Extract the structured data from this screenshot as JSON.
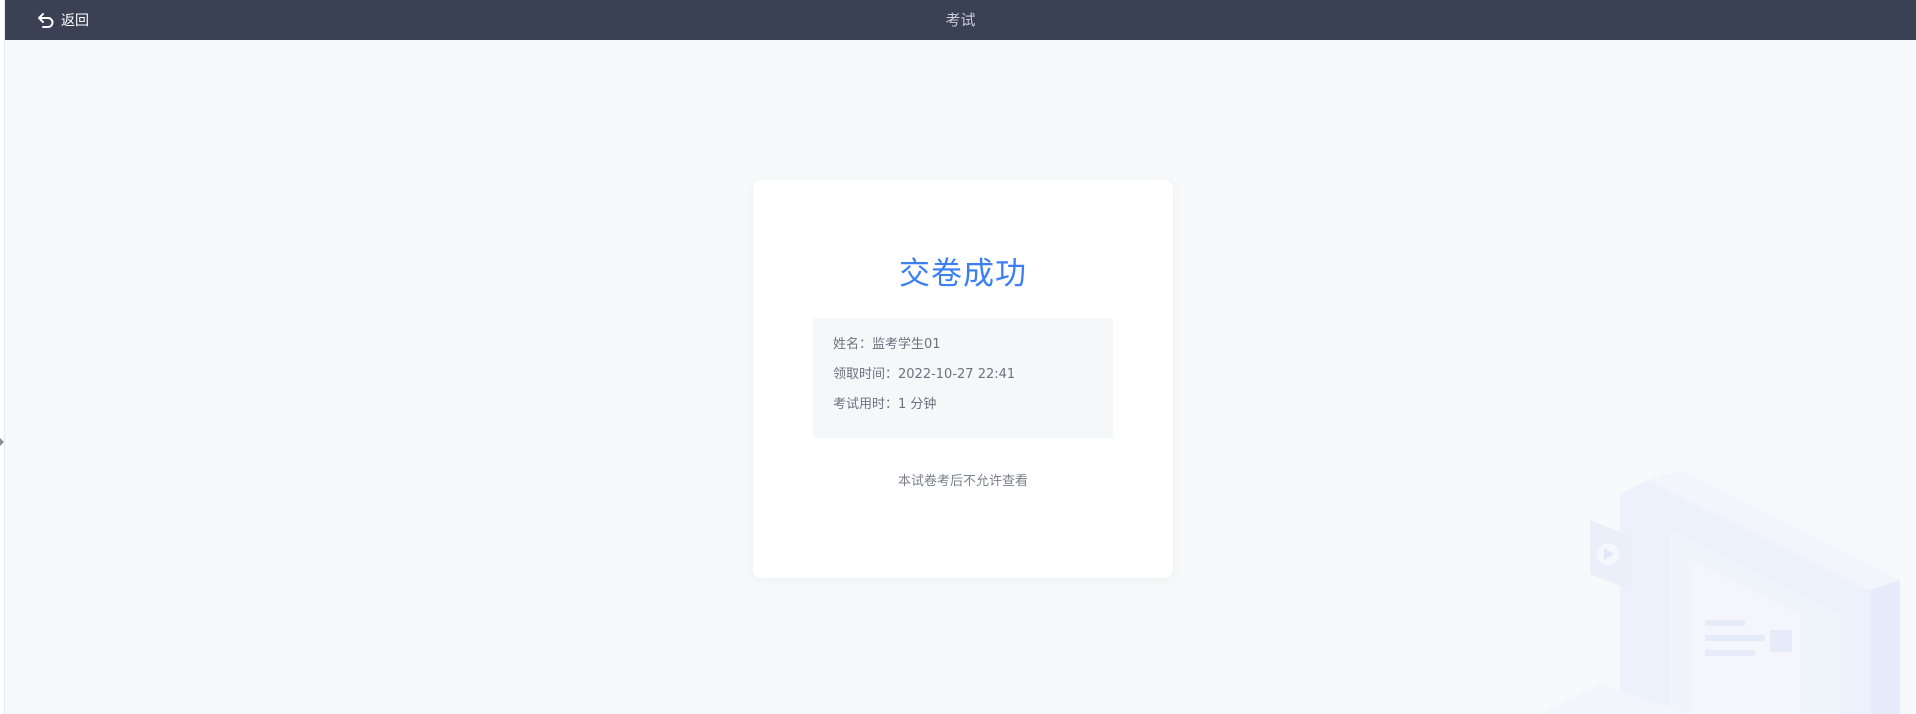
{
  "header": {
    "back_label": "返回",
    "title": "考试"
  },
  "result": {
    "title": "交卷成功",
    "rows": [
      {
        "label": "姓名：",
        "value": "监考学生01"
      },
      {
        "label": "领取时间：",
        "value": "2022-10-27 22:41"
      },
      {
        "label": "考试用时：",
        "value": "1 分钟"
      }
    ],
    "note": "本试卷考后不允许查看"
  },
  "colors": {
    "header_bg": "#3a4155",
    "accent": "#3b7ff2",
    "page_bg": "#f8f9fb"
  },
  "icons": {
    "back": "undo-arrow-icon",
    "sidebar_toggle": "caret-right-icon"
  }
}
